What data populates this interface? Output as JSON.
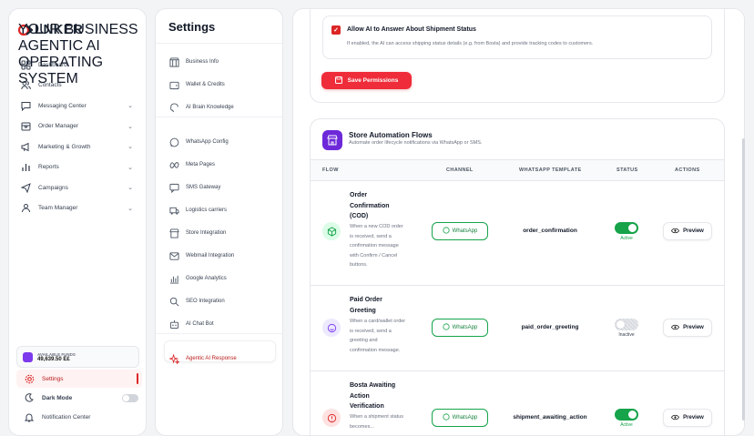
{
  "brand": {
    "name": "LNKER",
    "tagline": "YOUR BUSINESS AGENTIC AI OPERATING SYSTEM"
  },
  "sidebar": {
    "items": [
      {
        "label": "Dashboard",
        "icon": "grid-icon",
        "chevron": false
      },
      {
        "label": "Contacts",
        "icon": "users-icon",
        "chevron": false
      },
      {
        "label": "Messaging Center",
        "icon": "message-icon",
        "chevron": true
      },
      {
        "label": "Order Manager",
        "icon": "box-icon",
        "chevron": true
      },
      {
        "label": "Marketing & Growth",
        "icon": "megaphone-icon",
        "chevron": true
      },
      {
        "label": "Reports",
        "icon": "bar-chart-icon",
        "chevron": true
      },
      {
        "label": "Campaigns",
        "icon": "send-icon",
        "chevron": true
      },
      {
        "label": "Team Manager",
        "icon": "team-icon",
        "chevron": true
      }
    ],
    "funds": {
      "label": "AVAILABLE FUNDS",
      "value": "49,639.50 E£"
    },
    "settings_label": "Settings",
    "dark_mode_label": "Dark Mode",
    "notification_label": "Notification Center"
  },
  "settings_menu": {
    "title": "Settings",
    "items": [
      {
        "label": "Business Info",
        "icon": "store-icon"
      },
      {
        "label": "Wallet & Credits",
        "icon": "wallet-icon"
      },
      {
        "label": "AI Brain Knowledge",
        "icon": "brain-icon"
      },
      {
        "label": "WhatsApp Config",
        "icon": "whatsapp-icon"
      },
      {
        "label": "Meta Pages",
        "icon": "meta-icon"
      },
      {
        "label": "SMS Gateway",
        "icon": "sms-icon"
      },
      {
        "label": "Logistics carriers",
        "icon": "truck-icon"
      },
      {
        "label": "Store Integration",
        "icon": "shop-icon"
      },
      {
        "label": "Webmail Integration",
        "icon": "mail-icon"
      },
      {
        "label": "Google Analytics",
        "icon": "analytics-icon"
      },
      {
        "label": "SEO Integration",
        "icon": "seo-search-icon"
      },
      {
        "label": "AI Chat Bot",
        "icon": "bot-icon"
      },
      {
        "label": "Agentic AI Response",
        "icon": "sparkle-icon"
      }
    ]
  },
  "permissions": {
    "option_title": "Allow AI to Answer About Shipment Status",
    "option_desc": "If enabled, the AI can access shipping status details (e.g. from Bosta) and provide tracking codes to customers.",
    "save_label": "Save Permissions"
  },
  "automation": {
    "title": "Store Automation Flows",
    "subtitle": "Automate order lifecycle notifications via WhatsApp or SMS.",
    "columns": {
      "flow": "FLOW",
      "channel": "CHANNEL",
      "template": "WHATSAPP TEMPLATE",
      "status": "STATUS",
      "actions": "ACTIONS"
    },
    "channel_label": "WhatsApp",
    "preview_label": "Preview",
    "rows": [
      {
        "title": "Order Confirmation (COD)",
        "desc": "When a new COD order is received, send a confirmation message with Confirm / Cancel buttons.",
        "template": "order_confirmation",
        "status": "Active",
        "active": true
      },
      {
        "title": "Paid Order Greeting",
        "desc": "When a card/wallet order is received, send a greeting and confirmation message.",
        "template": "paid_order_greeting",
        "status": "Inactive",
        "active": false
      },
      {
        "title": "Bosta Awaiting Action Verification",
        "desc": "When a shipment status becomes...",
        "template": "shipment_awaiting_action",
        "status": "Active",
        "active": true
      }
    ]
  },
  "colors": {
    "accent": "#ef2d3a",
    "purple": "#6d28d9",
    "green": "#16a34a"
  }
}
